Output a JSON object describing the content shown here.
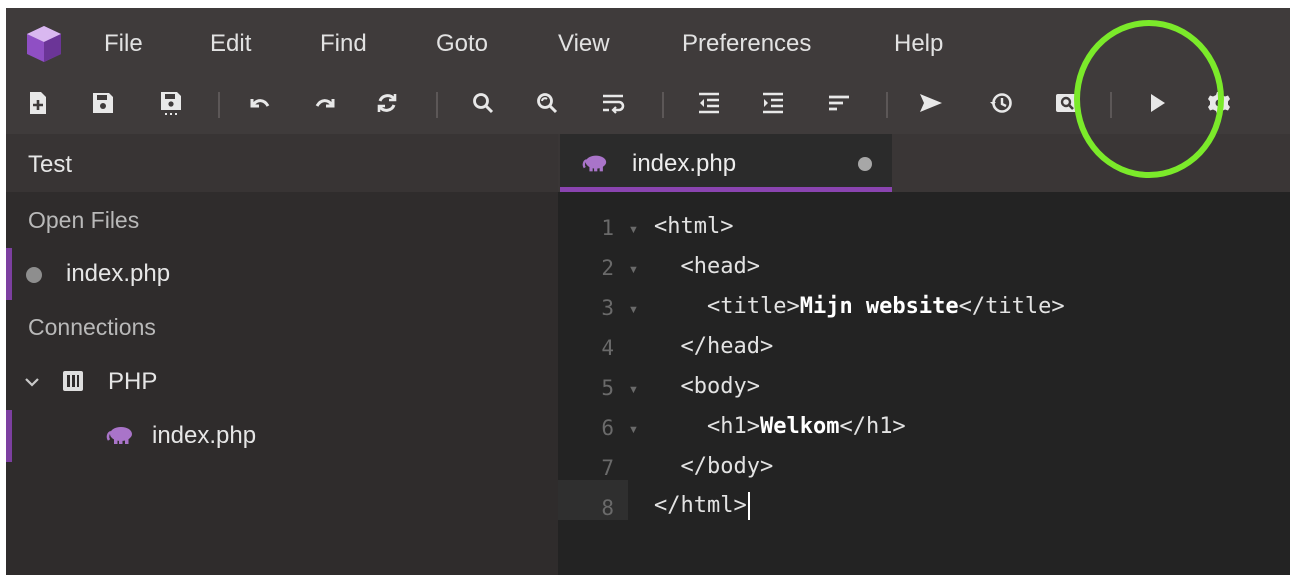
{
  "menu": {
    "items": [
      {
        "id": "file",
        "label": "File"
      },
      {
        "id": "edit",
        "label": "Edit"
      },
      {
        "id": "find",
        "label": "Find"
      },
      {
        "id": "goto",
        "label": "Goto"
      },
      {
        "id": "view",
        "label": "View"
      },
      {
        "id": "preferences",
        "label": "Preferences"
      },
      {
        "id": "help",
        "label": "Help"
      }
    ]
  },
  "toolbar": {
    "icons": [
      "new-file-icon",
      "save-icon",
      "save-all-icon",
      "undo-icon",
      "redo-icon",
      "reload-icon",
      "search-icon",
      "replace-icon",
      "wrap-icon",
      "outdent-icon",
      "indent-icon",
      "sort-icon",
      "send-icon",
      "history-icon",
      "preview-icon",
      "run-icon",
      "settings-icon"
    ]
  },
  "sidebar": {
    "title": "Test",
    "open_files_label": "Open Files",
    "open_files": [
      {
        "name": "index.php"
      }
    ],
    "connections_label": "Connections",
    "connection": {
      "name": "PHP"
    },
    "connection_files": [
      {
        "name": "index.php"
      }
    ]
  },
  "tab": {
    "label": "index.php"
  },
  "editor": {
    "lines": [
      {
        "num": "1",
        "parts": [
          "<html>"
        ]
      },
      {
        "num": "2",
        "parts": [
          "  <head>"
        ]
      },
      {
        "num": "3",
        "parts": [
          "    <title>",
          "Mijn website",
          "</title>"
        ]
      },
      {
        "num": "4",
        "parts": [
          "  </head>"
        ]
      },
      {
        "num": "5",
        "parts": [
          "  <body>"
        ]
      },
      {
        "num": "6",
        "parts": [
          "    <h1>",
          "Welkom",
          "</h1>"
        ]
      },
      {
        "num": "7",
        "parts": [
          "  </body>"
        ]
      },
      {
        "num": "8",
        "parts": [
          "</html>"
        ]
      }
    ]
  },
  "colors": {
    "accent": "#8a44b0",
    "highlight_circle": "#7bea2a",
    "php_icon": "#a974c9"
  }
}
